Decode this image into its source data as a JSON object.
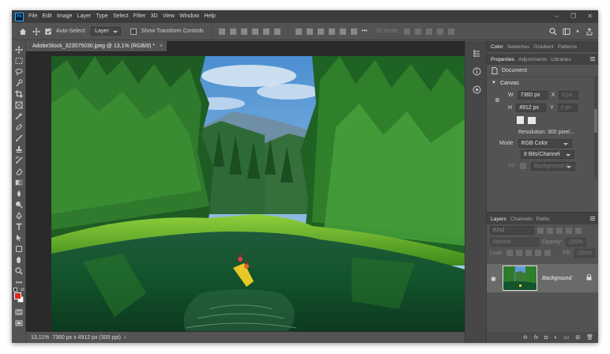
{
  "app": {
    "logo": "Ps"
  },
  "menu": [
    "File",
    "Edit",
    "Image",
    "Layer",
    "Type",
    "Select",
    "Filter",
    "3D",
    "View",
    "Window",
    "Help"
  ],
  "options": {
    "auto_select_label": "Auto-Select:",
    "auto_select_value": "Layer",
    "transform_label": "Show Transform Controls",
    "mode_3d": "3D Mode:"
  },
  "document": {
    "tab_title": "AdobeStock_323075030.jpeg @ 13,1% (RGB/8) *",
    "tab_close": "×"
  },
  "status": {
    "zoom": "13,11%",
    "info": "7360 px x 4912 px (300 ppi)"
  },
  "tools": [
    "move-tool",
    "marquee-tool",
    "lasso-tool",
    "quick-select-tool",
    "crop-tool",
    "frame-tool",
    "eyedropper-tool",
    "healing-tool",
    "brush-tool",
    "stamp-tool",
    "history-brush-tool",
    "eraser-tool",
    "gradient-tool",
    "blur-tool",
    "dodge-tool",
    "pen-tool",
    "type-tool",
    "path-select-tool",
    "shape-tool",
    "hand-tool",
    "zoom-tool",
    "more-tool"
  ],
  "panels": {
    "top_tabs": [
      "Color",
      "Swatches",
      "Gradient",
      "Patterns"
    ],
    "prop_tabs": [
      "Properties",
      "Adjustments",
      "Libraries"
    ],
    "prop_subject": "Document",
    "canvas_section": "Canvas",
    "width_label": "W",
    "width_value": "7360 px",
    "x_label": "X",
    "x_value": "0 px",
    "height_label": "H",
    "height_value": "4912 px",
    "y_label": "Y",
    "y_value": "0 px",
    "resolution": "Resolution: 300 pixel...",
    "mode_label": "Mode",
    "mode_value": "RGB Color",
    "bits_value": "8 Bits/Channel",
    "fill_label": "Fill",
    "fill_value": "Background C..."
  },
  "layers": {
    "tabs": [
      "Layers",
      "Channels",
      "Paths"
    ],
    "kind": "Kind",
    "blend": "Normal",
    "opacity_label": "Opacity:",
    "opacity_value": "100%",
    "lock_label": "Lock:",
    "fill_label": "Fill:",
    "fill_value": "100%",
    "layer_name": "Background"
  },
  "colors": {
    "foreground": "#e0251b",
    "background": "#ffffff",
    "accent": "#31a8ff"
  }
}
